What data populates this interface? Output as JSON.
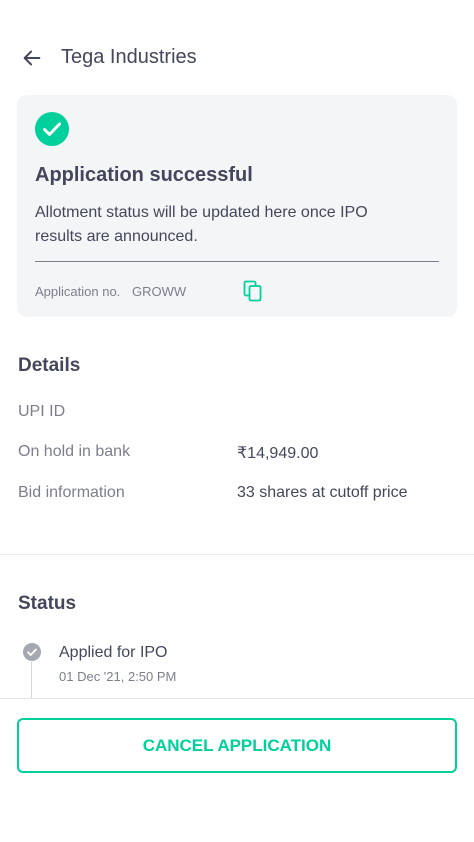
{
  "header": {
    "title": "Tega Industries",
    "back_icon": "arrow-left-icon"
  },
  "card": {
    "icon": "check-circle-icon",
    "title": "Application successful",
    "description": "Allotment status will be updated here once IPO results are announced.",
    "application_label": "Application no.",
    "application_value": "GROWW",
    "copy_icon": "copy-icon"
  },
  "details": {
    "title": "Details",
    "rows": [
      {
        "label": "UPI ID",
        "value": ""
      },
      {
        "label": "On hold in bank",
        "value": "₹14,949.00"
      },
      {
        "label": "Bid information",
        "value": "33 shares at cutoff price"
      }
    ]
  },
  "status": {
    "title": "Status",
    "items": [
      {
        "text": "Applied for IPO",
        "time": "01 Dec '21, 2:50 PM",
        "icon": "check-circle-icon"
      }
    ]
  },
  "actions": {
    "cancel_label": "CANCEL APPLICATION"
  },
  "colors": {
    "accent": "#00d09c",
    "text_primary": "#44475b",
    "text_secondary": "#7c7e8c",
    "card_bg": "#f4f5f7",
    "status_dot": "#a5a7b1"
  }
}
